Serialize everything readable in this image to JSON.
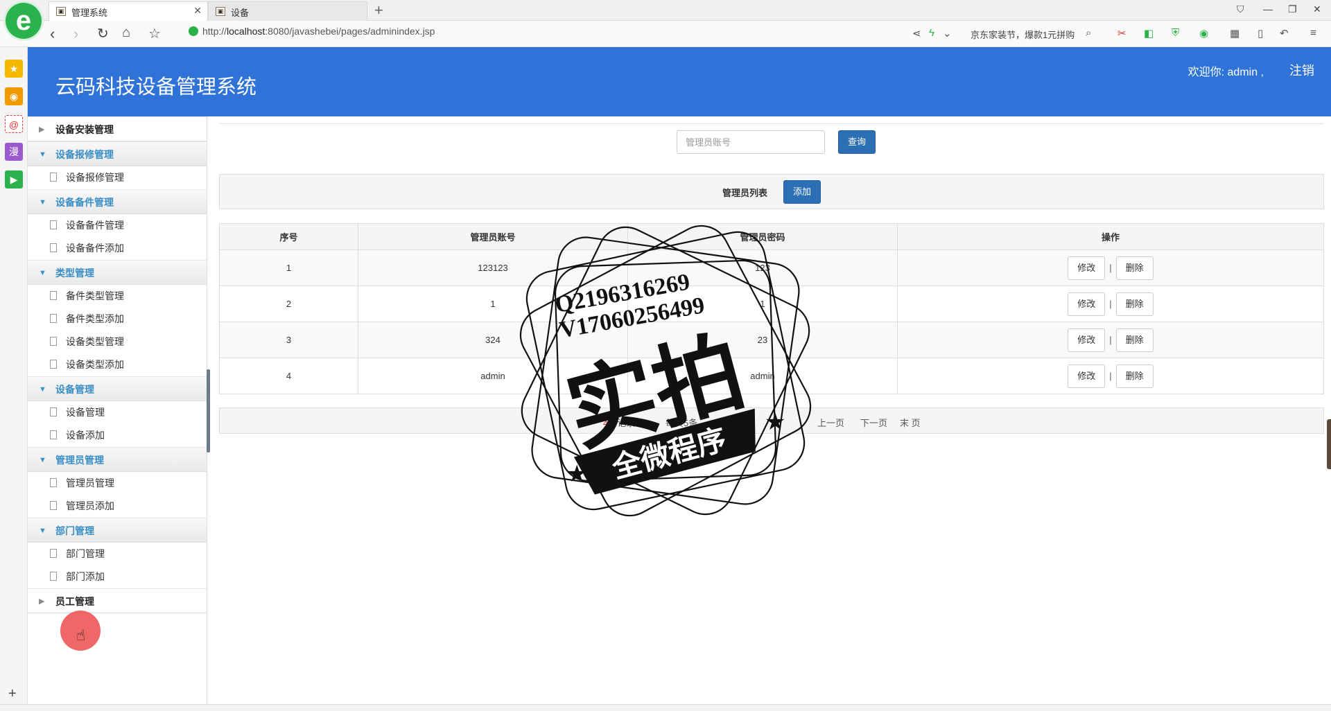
{
  "browser": {
    "tabs": [
      {
        "label": "管理系统",
        "active": true
      },
      {
        "label": "设备",
        "active": false
      }
    ],
    "url": {
      "prefix": "http://",
      "host": "localhost",
      "rest": ":8080/javashebei/pages/adminindex.jsp"
    },
    "promo_text": "京东家装节，爆款1元拼购"
  },
  "header": {
    "title": "云码科技设备管理系统",
    "welcome": "欢迎你: admin ,",
    "logout": "注销"
  },
  "menu": {
    "groups": [
      {
        "label": "设备安装管理",
        "expanded": false,
        "items": []
      },
      {
        "label": "设备报修管理",
        "expanded": true,
        "items": [
          "设备报修管理"
        ]
      },
      {
        "label": "设备备件管理",
        "expanded": true,
        "items": [
          "设备备件管理",
          "设备备件添加"
        ]
      },
      {
        "label": "类型管理",
        "expanded": true,
        "items": [
          "备件类型管理",
          "备件类型添加",
          "设备类型管理",
          "设备类型添加"
        ]
      },
      {
        "label": "设备管理",
        "expanded": true,
        "items": [
          "设备管理",
          "设备添加"
        ]
      },
      {
        "label": "管理员管理",
        "expanded": true,
        "items": [
          "管理员管理",
          "管理员添加"
        ]
      },
      {
        "label": "部门管理",
        "expanded": true,
        "items": [
          "部门管理",
          "部门添加"
        ]
      },
      {
        "label": "员工管理",
        "expanded": false,
        "items": []
      }
    ]
  },
  "search": {
    "placeholder": "管理员账号",
    "button": "查询"
  },
  "panel": {
    "title": "管理员列表",
    "add_button": "添加"
  },
  "table": {
    "headers": [
      "序号",
      "管理员账号",
      "管理员密码",
      "操作"
    ],
    "rows": [
      {
        "no": "1",
        "account": "123123",
        "password": "123"
      },
      {
        "no": "2",
        "account": "1",
        "password": "1"
      },
      {
        "no": "3",
        "account": "324",
        "password": "23"
      },
      {
        "no": "4",
        "account": "admin",
        "password": "admin"
      }
    ],
    "edit_label": "修改",
    "delete_label": "删除",
    "separator": "|"
  },
  "pager": {
    "records": "条记录",
    "per_page": "每页5条",
    "prev": "上一页",
    "next": "下一页",
    "last": "末 页"
  },
  "watermark": {
    "line1": "Q2196316269",
    "line2": "V17060256499",
    "big": "实拍",
    "banner": "全微程序"
  },
  "icons": {
    "browser_logo": "e",
    "sidebar": [
      "star-icon",
      "weibo-icon",
      "mail-icon",
      "comic-icon",
      "video-icon"
    ]
  }
}
